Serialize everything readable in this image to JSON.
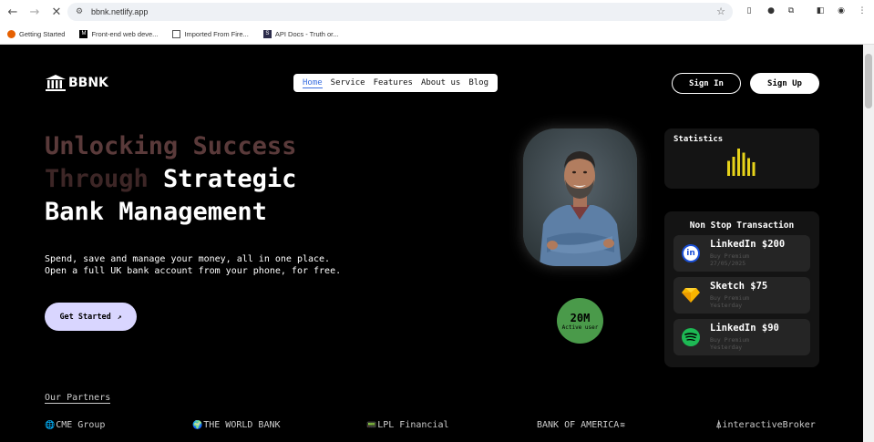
{
  "browser": {
    "url": "bbnk.netlify.app",
    "bookmarks": [
      {
        "label": "Getting Started",
        "icon": "firefox-icon"
      },
      {
        "label": "Front-end web deve...",
        "icon": "mdn-icon"
      },
      {
        "label": "Imported From Fire...",
        "icon": "folder-icon"
      },
      {
        "label": "API Docs - Truth or...",
        "icon": "api-docs-icon"
      }
    ]
  },
  "site": {
    "logo": "BBNK",
    "nav": [
      "Home",
      "Service",
      "Features",
      "About us",
      "Blog"
    ],
    "signin": "Sign In",
    "signup": "Sign Up",
    "headline": {
      "l1a": "Unlocking Success",
      "l2a": "Through ",
      "l2b": "Strategic",
      "l3": "Bank Management"
    },
    "subtext": {
      "l1": "Spend, save and manage your money, all in one place.",
      "l2": "Open a full UK bank account from your phone, for free."
    },
    "cta": "Get Started",
    "cta_arrow": "↗",
    "users_badge": {
      "value": "20M",
      "label": "Active user"
    },
    "statistics": {
      "title": "Statistics",
      "bars": [
        0.55,
        0.7,
        1.0,
        0.85,
        0.65,
        0.5
      ],
      "color": "#e6d21a"
    },
    "transactions": {
      "title": "Non Stop Transaction",
      "items": [
        {
          "name": "LinkedIn $200",
          "line1": "Buy Premium",
          "line2": "27/05/2025",
          "icon": "linkedin-icon"
        },
        {
          "name": "Sketch $75",
          "line1": "Buy Premium",
          "line2": "Yesterday",
          "icon": "sketch-icon"
        },
        {
          "name": "LinkedIn $90",
          "line1": "Buy Premium",
          "line2": "Yesterday",
          "icon": "spotify-icon"
        }
      ]
    },
    "partners_title": "Our Partners",
    "partners": [
      {
        "icon": "🌐",
        "label": "CME Group"
      },
      {
        "icon": "🌍",
        "label": "THE WORLD BANK"
      },
      {
        "icon": "📟",
        "label": "LPL Financial"
      },
      {
        "icon": "",
        "label": "BANK OF AMERICA"
      },
      {
        "icon": "⍋",
        "label": "interactiveBroker"
      }
    ],
    "partners_suffix_boa": "≋",
    "colors": {
      "accent": "#3b6fe0",
      "cta_bg": "#d9d6ff",
      "badge_bg": "#4a9a4a",
      "card_bg": "#141414"
    }
  }
}
